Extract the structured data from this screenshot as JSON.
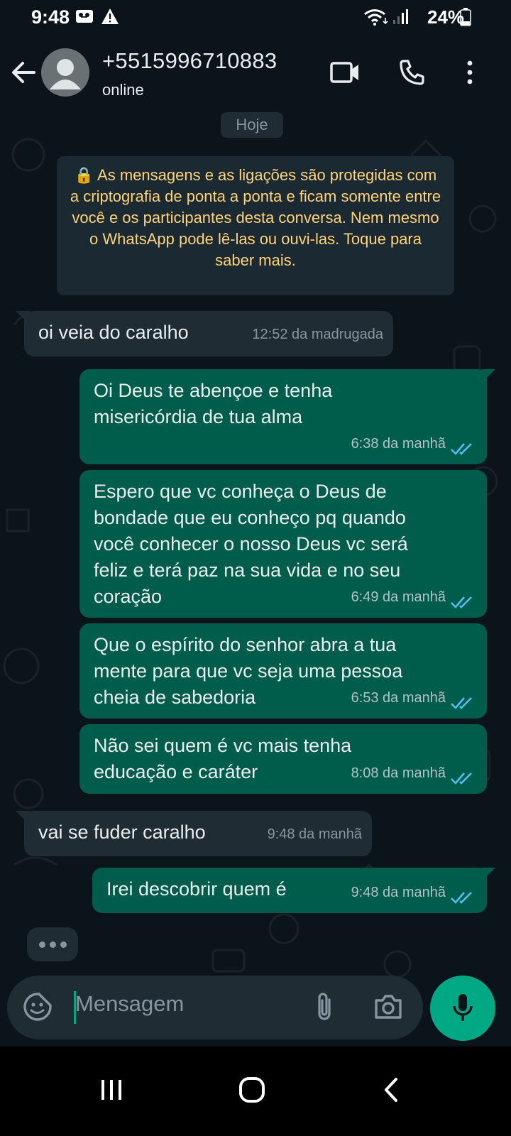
{
  "status_bar": {
    "time": "9:48",
    "battery": "24%"
  },
  "header": {
    "contact_name": "+5515996710883",
    "contact_status": "online"
  },
  "chat": {
    "date_chip": "Hoje",
    "encryption_notice": "🔒 As mensagens e as ligações são protegidas com a criptografia de ponta a ponta e ficam somente entre você e os participantes desta conversa. Nem mesmo o WhatsApp pode lê-las ou ouvi-las. Toque para saber mais.",
    "messages": [
      {
        "direction": "in",
        "lines": [
          "oi veia do caralho"
        ],
        "time": "12:52 da madrugada"
      },
      {
        "direction": "out",
        "lines": [
          "Oi Deus te abençoe e tenha",
          "misericórdia de tua alma"
        ],
        "time": "6:38 da manhã",
        "read": true
      },
      {
        "direction": "out",
        "lines": [
          "Espero que vc conheça o Deus de",
          "bondade que eu conheço pq quando",
          "você conhecer o nosso Deus vc será",
          "feliz e terá paz na sua vida e no seu",
          "coração"
        ],
        "time": "6:49 da manhã",
        "read": true
      },
      {
        "direction": "out",
        "lines": [
          "Que o espírito do senhor abra a tua",
          "mente para que vc seja uma pessoa",
          "cheia de sabedoria"
        ],
        "time": "6:53 da manhã",
        "read": true
      },
      {
        "direction": "out",
        "lines": [
          "Não sei quem é vc mais tenha",
          "educação e caráter"
        ],
        "time": "8:08 da manhã",
        "read": true
      },
      {
        "direction": "in",
        "lines": [
          "vai se fuder caralho"
        ],
        "time": "9:48 da manhã"
      },
      {
        "direction": "out",
        "lines": [
          "Irei descobrir quem é"
        ],
        "time": "9:48 da manhã",
        "read": true
      }
    ]
  },
  "composer": {
    "placeholder": "Mensagem"
  },
  "colors": {
    "background": "#0b141a",
    "incoming_bubble": "#202c33",
    "outgoing_bubble": "#005c4b",
    "accent": "#00a884",
    "read_ticks": "#53bdeb",
    "notice_text": "#ffd279"
  },
  "icons": [
    "back-arrow-icon",
    "avatar-placeholder-icon",
    "video-call-icon",
    "phone-icon",
    "more-options-icon",
    "lock-icon",
    "double-check-icon",
    "sticker-icon",
    "attach-icon",
    "camera-icon",
    "mic-icon"
  ]
}
